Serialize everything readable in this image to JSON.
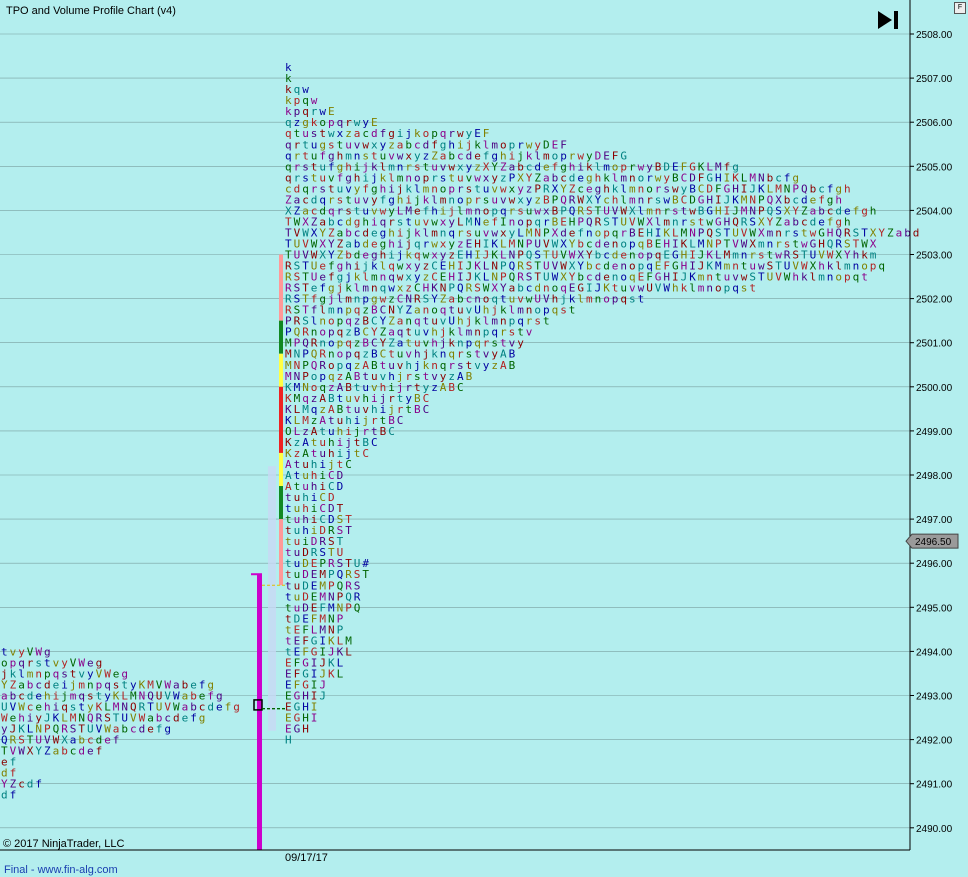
{
  "header": {
    "title": "TPO and Volume Profile Chart (v4)",
    "f_button": "F"
  },
  "footer": {
    "copyright": "© 2017 NinjaTrader, LLC",
    "final_text": "Final - www.fin-alg.com",
    "date_label": "09/17/17"
  },
  "colors": {
    "background": "#b3eeee",
    "grid": "#7aa0a0",
    "poc_bar": "#cc00cc",
    "price_marker": "#9a9a9a",
    "tpo_palette": [
      "#0000a0",
      "#006400",
      "#8b0000",
      "#808000",
      "#8b008b",
      "#008080",
      "#b22222",
      "#4b0082"
    ],
    "value_area": [
      "#ff9999",
      "#ffff44",
      "#ee2222",
      "#118822"
    ]
  },
  "price_marker": {
    "label": "2496.50",
    "price": 2496.5
  },
  "chart_data": {
    "type": "table",
    "title": "TPO and Volume Profile Chart (v4)",
    "y_axis": {
      "min": 2490,
      "max": 2508,
      "step": 1,
      "ticks": [
        "2508.00",
        "2507.00",
        "2506.00",
        "2505.00",
        "2504.00",
        "2503.00",
        "2502.00",
        "2501.00",
        "2500.00",
        "2499.00",
        "2498.00",
        "2497.00",
        "2496.00",
        "2495.00",
        "2494.00",
        "2493.00",
        "2492.00",
        "2491.00",
        "2490.00"
      ],
      "grid": true
    },
    "prior_profile": {
      "rows": [
        {
          "price": 2494.0,
          "letters": "tvyVWg"
        },
        {
          "price": 2493.75,
          "letters": "opqrstvyVWeg"
        },
        {
          "price": 2493.5,
          "letters": "jklmnpqstvyVWeg"
        },
        {
          "price": 2493.25,
          "letters": "YZabcdeijmnpqstyKMVWabefg"
        },
        {
          "price": 2493.0,
          "letters": "abcdehijmqstyKLMNQUVWabefg"
        },
        {
          "price": 2492.75,
          "letters": "UVWcehiqstyKLMNQRTUVWabcdefg"
        },
        {
          "price": 2492.5,
          "letters": "WehiyJKLMNQRSTUVWabcdefg"
        },
        {
          "price": 2492.25,
          "letters": "yJKLNPQRSTUVWabcdefg"
        },
        {
          "price": 2492.0,
          "letters": "QRSTUVWXabcdef"
        },
        {
          "price": 2491.75,
          "letters": "TVWXYZabcdef"
        },
        {
          "price": 2491.5,
          "letters": "ef"
        },
        {
          "price": 2491.25,
          "letters": "df"
        },
        {
          "price": 2491.0,
          "letters": "YZcdf"
        },
        {
          "price": 2490.75,
          "letters": "df"
        }
      ]
    },
    "current_profile": {
      "date": "09/17/17",
      "rows": [
        {
          "price": 2507.25,
          "letters": "k"
        },
        {
          "price": 2507.0,
          "letters": "k"
        },
        {
          "price": 2506.75,
          "letters": "kqw"
        },
        {
          "price": 2506.5,
          "letters": "kpqw"
        },
        {
          "price": 2506.25,
          "letters": "kpqrwE"
        },
        {
          "price": 2506.0,
          "letters": "qzgkopqrwyE"
        },
        {
          "price": 2505.75,
          "letters": "qtustwxzacdfgijkopqrwyEF"
        },
        {
          "price": 2505.5,
          "letters": "qrtugstuvwxyzabcdfghijklmoprwyDEF"
        },
        {
          "price": 2505.25,
          "letters": "qrtufghmnstuvwxyzZabcdefghijklmoprwyDEFG"
        },
        {
          "price": 2505.0,
          "letters": "qrstufghijklmnrstuvwxyzXYZabcdefghiklmoprwyBDEFGKLMfg"
        },
        {
          "price": 2504.75,
          "letters": "qrstuvfghijklmnoprstuvwxyzPXYZabcdeghklmnorwyBCDFGHIKLMNbcfg"
        },
        {
          "price": 2504.5,
          "letters": "cdqrstuvyfghijklmnoprstuvwxyzPRXYZceghklmnorswyBCDFGHIJKLMNPQbcfgh"
        },
        {
          "price": 2504.25,
          "letters": "ZacdqrstuvyfghijklmnoprsuvwxyzBPQRWXYchlmnrswBCDGHIJKMNPQXbcdefgh"
        },
        {
          "price": 2504.0,
          "letters": "XZacdqrstuvwyLMefhijlmnopqrsuwxBPQRSTUVWXlmnrstwBGHIJMNPQSXYZabcdefgh"
        },
        {
          "price": 2503.75,
          "letters": "TWXZabcdghiqrstuvwxyLMNefInopqrBEHPQRSTUVWXlmnrstwGHQRSXYZabcdefgh"
        },
        {
          "price": 2503.5,
          "letters": "TVWXYZabcdeghijklmnqrsuvwxyLMNPXdefnopqrBEHIKLMNPQSTUVWXmnrstwGHQRSTXYZabd"
        },
        {
          "price": 2503.25,
          "letters": "TUVWXYZabdeghijqrwxyzEHIKLMNPUVWXYbcdenopqBEHIKLMNPTVWXmnrstwGHQRSTWX"
        },
        {
          "price": 2503.0,
          "letters": "TUVWXYZbdeghijkqwxyzEHIJKLNPQSTUVWXYbcdenopqEGHIJKLMmnrstwRSTUVWXYhkm"
        },
        {
          "price": 2502.75,
          "letters": "RSTUefghijklqwxyzCEHIJKLNPQRSTUVWXYbcdenopqEFGHIJKMmntuwSTUVWXhklmnopq"
        },
        {
          "price": 2502.5,
          "letters": "RSTUefgjklmnqwxyzCEHIJKLNPQRSTUWXYbcdenoqEFGHIJKmntuvwSTUVWhklmnopqt"
        },
        {
          "price": 2502.25,
          "letters": "RSTefgjklmnqwxzCHKNPQRSWXYabcdnoqEGIJKtuvwUVWhklmnopqst"
        },
        {
          "price": 2502.0,
          "letters": "RSTfgjlmnpgwzCNRSYZabcnoqtuvwUVhjklmnopqst"
        },
        {
          "price": 2501.75,
          "letters": "RSTflmnpqzBCNYZanoqtuvUhjklmnopqst"
        },
        {
          "price": 2501.5,
          "letters": "PRSlnopqzBCYZanqtuvUhjklmnpqrst"
        },
        {
          "price": 2501.25,
          "letters": "PQRnopqzBCYZaqtuvhjklmnpqrstv"
        },
        {
          "price": 2501.0,
          "letters": "MPQRnopqzBCYZatuvhjknpqrstvy"
        },
        {
          "price": 2500.75,
          "letters": "MNPQRnopqzBCtuvhjknqrstvyAB"
        },
        {
          "price": 2500.5,
          "letters": "MNPQRopqzABtuvhjknqrstvyzAB"
        },
        {
          "price": 2500.25,
          "letters": "MNPopqzABtuvhjrstvyzAB"
        },
        {
          "price": 2500.0,
          "letters": "KMNoqzABtuvhijrtyzABC"
        },
        {
          "price": 2499.75,
          "letters": "KMqzABtuvhijrtyBC"
        },
        {
          "price": 2499.5,
          "letters": "KLMqzABtuvhijrtBC"
        },
        {
          "price": 2499.25,
          "letters": "KLMzAtuhijrtBC"
        },
        {
          "price": 2499.0,
          "letters": "OLzAtuhijrtBC"
        },
        {
          "price": 2498.75,
          "letters": "KzAtuhijtBC"
        },
        {
          "price": 2498.5,
          "letters": "KzAtuhijtC"
        },
        {
          "price": 2498.25,
          "letters": "AtuhijtC"
        },
        {
          "price": 2498.0,
          "letters": "AtuhiCD"
        },
        {
          "price": 2497.75,
          "letters": "AtuhiCD"
        },
        {
          "price": 2497.5,
          "letters": "tuhiCD"
        },
        {
          "price": 2497.25,
          "letters": "tuhiCDT"
        },
        {
          "price": 2497.0,
          "letters": "tuhiCDST"
        },
        {
          "price": 2496.75,
          "letters": "tuhiDRST"
        },
        {
          "price": 2496.5,
          "letters": "tuiDRST"
        },
        {
          "price": 2496.25,
          "letters": "tuDRSTU"
        },
        {
          "price": 2496.0,
          "letters": "tuDEPRSTU#"
        },
        {
          "price": 2495.75,
          "letters": "tuDEMPQRST"
        },
        {
          "price": 2495.5,
          "letters": "tuDEMPQRS"
        },
        {
          "price": 2495.25,
          "letters": "tuDEMNPQR"
        },
        {
          "price": 2495.0,
          "letters": "tuDEFMNPQ"
        },
        {
          "price": 2494.75,
          "letters": "tDEFMNP"
        },
        {
          "price": 2494.5,
          "letters": "tEFLMNP"
        },
        {
          "price": 2494.25,
          "letters": "tEFGIKLM"
        },
        {
          "price": 2494.0,
          "letters": "tEFGIJKL"
        },
        {
          "price": 2493.75,
          "letters": "EFGIJKL"
        },
        {
          "price": 2493.5,
          "letters": "EFGIJKL"
        },
        {
          "price": 2493.25,
          "letters": "EFGIJ"
        },
        {
          "price": 2493.0,
          "letters": "EGHIJ"
        },
        {
          "price": 2492.75,
          "letters": "EGHI"
        },
        {
          "price": 2492.5,
          "letters": "EGHI"
        },
        {
          "price": 2492.25,
          "letters": "EGH"
        },
        {
          "price": 2492.0,
          "letters": "H"
        }
      ]
    },
    "value_area_bands": [
      {
        "from": 2501.5,
        "to": 2503.0,
        "color": "#ff9999"
      },
      {
        "from": 2500.75,
        "to": 2501.5,
        "color": "#118822"
      },
      {
        "from": 2500.0,
        "to": 2500.75,
        "color": "#ffff44"
      },
      {
        "from": 2498.5,
        "to": 2500.0,
        "color": "#ee2222"
      },
      {
        "from": 2497.75,
        "to": 2498.5,
        "color": "#ffff44"
      },
      {
        "from": 2497.0,
        "to": 2497.75,
        "color": "#118822"
      },
      {
        "from": 2495.5,
        "to": 2497.0,
        "color": "#ff9999"
      }
    ],
    "poc_bar": {
      "from": 2489.5,
      "to": 2495.75
    },
    "legend": "none"
  }
}
